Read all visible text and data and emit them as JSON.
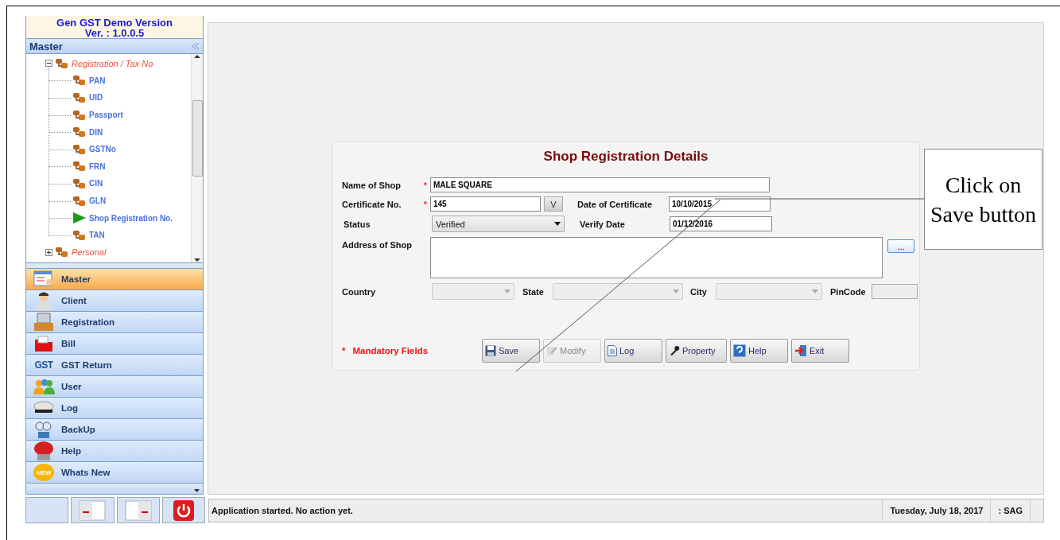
{
  "app_banner": {
    "title": "Gen GST Demo Version",
    "version": "Ver. : 1.0.0.5"
  },
  "sidebar": {
    "header": "Master",
    "tree": [
      {
        "label": "Registration / Tax No",
        "expanded": true,
        "children": [
          {
            "label": "PAN",
            "selected": false
          },
          {
            "label": "UID",
            "selected": false
          },
          {
            "label": "Passport",
            "selected": false
          },
          {
            "label": "DIN",
            "selected": false
          },
          {
            "label": "GSTNo",
            "selected": false
          },
          {
            "label": "FRN",
            "selected": false
          },
          {
            "label": "CIN",
            "selected": false
          },
          {
            "label": "GLN",
            "selected": false
          },
          {
            "label": "Shop Registration No.",
            "selected": true
          },
          {
            "label": "TAN",
            "selected": false
          }
        ]
      },
      {
        "label": "Personal",
        "expanded": false
      }
    ]
  },
  "nav": [
    {
      "label": "Master",
      "selected": true
    },
    {
      "label": "Client",
      "selected": false
    },
    {
      "label": "Registration",
      "selected": false
    },
    {
      "label": "Bill",
      "selected": false
    },
    {
      "label": "GST Return",
      "selected": false,
      "badge": "GST"
    },
    {
      "label": "User",
      "selected": false
    },
    {
      "label": "Log",
      "selected": false
    },
    {
      "label": "BackUp",
      "selected": false
    },
    {
      "label": "Help",
      "selected": false
    },
    {
      "label": "Whats New",
      "selected": false,
      "badge": "NEW"
    }
  ],
  "form": {
    "title": "Shop Registration Details",
    "name_of_shop": {
      "label": "Name of Shop",
      "required": true,
      "value": "MALE SQUARE"
    },
    "certificate_no": {
      "label": "Certificate No.",
      "required": true,
      "value": "145",
      "verify_button": "V"
    },
    "date_of_certificate": {
      "label": "Date of Certificate",
      "value": "10/10/2015"
    },
    "status": {
      "label": "Status",
      "value": "Verified"
    },
    "verify_date": {
      "label": "Verify Date",
      "value": "01/12/2016"
    },
    "address": {
      "label": "Address of Shop",
      "button": "..."
    },
    "country": {
      "label": "Country",
      "disabled": true
    },
    "state": {
      "label": "State",
      "disabled": true
    },
    "city": {
      "label": "City",
      "disabled": true
    },
    "pincode": {
      "label": "PinCode",
      "disabled": true
    },
    "mandatory_note": {
      "mark": "*",
      "text": "Mandatory Fields"
    },
    "buttons": [
      {
        "label": "Save",
        "disabled": false
      },
      {
        "label": "Modify",
        "disabled": true
      },
      {
        "label": "Log",
        "disabled": false
      },
      {
        "label": "Property",
        "disabled": false
      },
      {
        "label": "Help",
        "disabled": false
      },
      {
        "label": "Exit",
        "disabled": false
      }
    ]
  },
  "status_bar": {
    "message": "Application started. No action yet.",
    "date": "Tuesday, July 18, 2017",
    "user": ": SAG"
  },
  "callout": {
    "text": "Click on Save button"
  }
}
